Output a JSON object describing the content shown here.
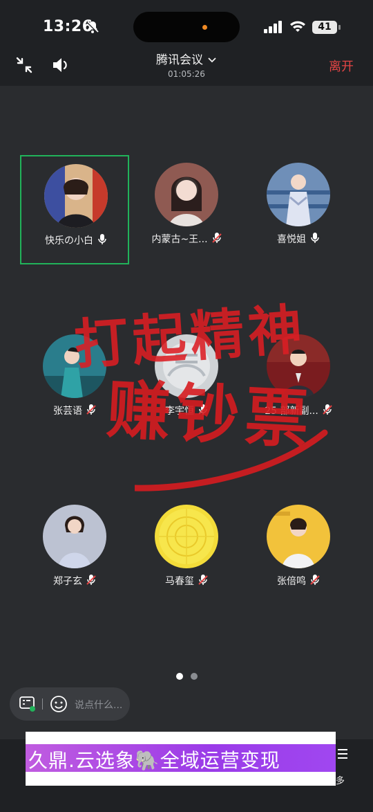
{
  "status_bar": {
    "time": "13:26",
    "battery": "41"
  },
  "header": {
    "title": "腾讯会议",
    "timer": "01:05:26",
    "leave_label": "离开"
  },
  "participants": [
    {
      "name": "快乐の小白",
      "mic": "on"
    },
    {
      "name": "内蒙古~王...",
      "mic": "muted"
    },
    {
      "name": "喜悦姐",
      "mic": "on"
    },
    {
      "name": "张芸语",
      "mic": "muted"
    },
    {
      "name": "李宇恒",
      "mic": "muted"
    },
    {
      "name": "25 部新副...",
      "mic": "muted"
    },
    {
      "name": "郑子玄",
      "mic": "muted"
    },
    {
      "name": "马春玺",
      "mic": "muted"
    },
    {
      "name": "张倍鸣",
      "mic": "muted"
    }
  ],
  "overlay": {
    "line1": "打起精神",
    "line2": "赚钞票"
  },
  "pagination": {
    "current": 1,
    "total": 2
  },
  "chat": {
    "placeholder": "说点什么..."
  },
  "banner": {
    "text": "久鼎.云选象🐘全域运营变现"
  },
  "toolbar": {
    "more_label": "多"
  },
  "colors": {
    "leave": "#e44545",
    "active_border": "#21b35a",
    "banner": "#9a3be8"
  }
}
